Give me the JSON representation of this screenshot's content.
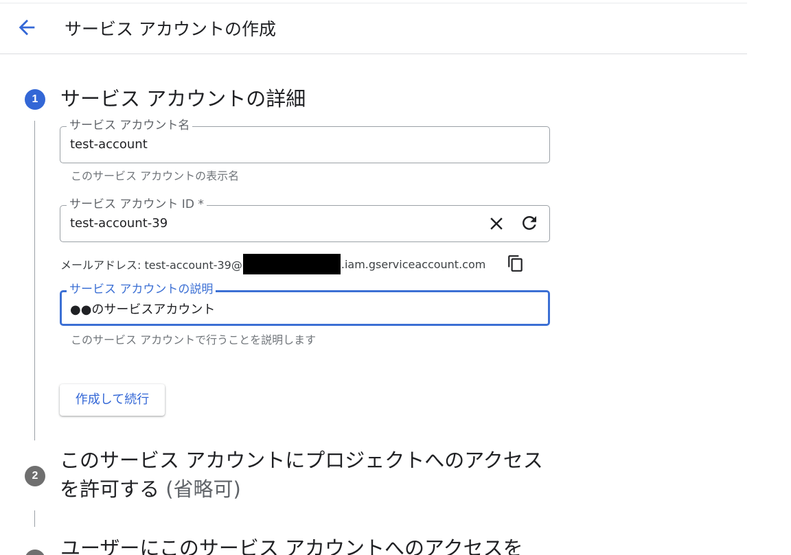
{
  "header": {
    "back_icon": "arrow-back-icon",
    "title": "サービス アカウントの作成"
  },
  "steps": [
    {
      "number": "1",
      "title": "サービス アカウントの詳細",
      "state": "active"
    },
    {
      "number": "2",
      "title_main": "このサービス アカウントにプロジェクトへのアクセスを許可する",
      "title_optional": "(省略可)",
      "state": "inactive"
    },
    {
      "number": "3",
      "title": "ユーザーにこのサービス アカウントへのアクセスを",
      "state": "inactive"
    }
  ],
  "form": {
    "name_field": {
      "label": "サービス アカウント名",
      "value": "test-account",
      "helper": "このサービス アカウントの表示名"
    },
    "id_field": {
      "label": "サービス アカウント ID *",
      "value": "test-account-39",
      "clear_icon": "close-icon",
      "refresh_icon": "refresh-icon"
    },
    "email": {
      "prefix": "メールアドレス: test-account-39@",
      "suffix": ".iam.gserviceaccount.com",
      "copy_icon": "copy-icon"
    },
    "description_field": {
      "label": "サービス アカウントの説明",
      "value": "●●のサービスアカウント",
      "helper": "このサービス アカウントで行うことを説明します"
    },
    "create_button": "作成して続行"
  },
  "colors": {
    "accent": "#3367d6",
    "focus_border": "#3b6fd4",
    "inactive_badge": "#6f6f6f",
    "text_primary": "#202124",
    "text_secondary": "#5f6368"
  }
}
